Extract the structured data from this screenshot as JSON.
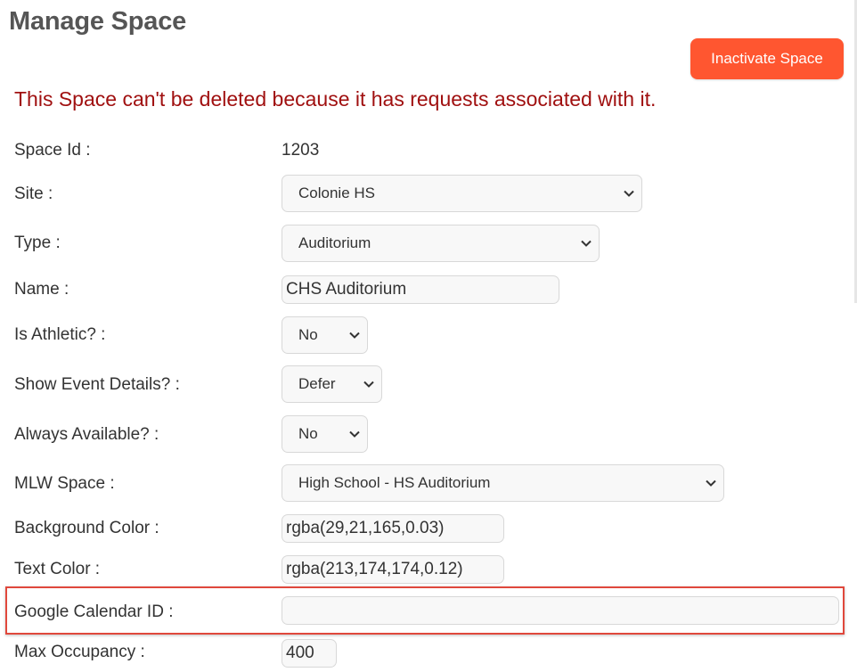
{
  "page": {
    "title": "Manage Space"
  },
  "actions": {
    "inactivate_label": "Inactivate Space"
  },
  "warning": "This Space can't be deleted because it has requests associated with it.",
  "fields": {
    "space_id": {
      "label": "Space Id :",
      "value": "1203"
    },
    "site": {
      "label": "Site :",
      "value": "Colonie HS"
    },
    "type": {
      "label": "Type :",
      "value": "Auditorium"
    },
    "name": {
      "label": "Name :",
      "value": "CHS Auditorium"
    },
    "is_athletic": {
      "label": "Is Athletic? :",
      "value": "No"
    },
    "show_event_details": {
      "label": "Show Event Details? :",
      "value": "Defer"
    },
    "always_available": {
      "label": "Always Available? :",
      "value": "No"
    },
    "mlw_space": {
      "label": "MLW Space :",
      "value": "High School - HS Auditorium"
    },
    "background_color": {
      "label": "Background Color :",
      "value": "rgba(29,21,165,0.03)"
    },
    "text_color": {
      "label": "Text Color :",
      "value": "rgba(213,174,174,0.12)"
    },
    "google_calendar_id": {
      "label": "Google Calendar ID :",
      "value": ""
    },
    "max_occupancy": {
      "label": "Max Occupancy :",
      "value": "400"
    }
  },
  "colors": {
    "accent_button": "#ff5630",
    "warning_text": "#a01010",
    "highlight_border": "#e0483c"
  },
  "icons": {
    "select_caret": "chevron-down-icon"
  }
}
